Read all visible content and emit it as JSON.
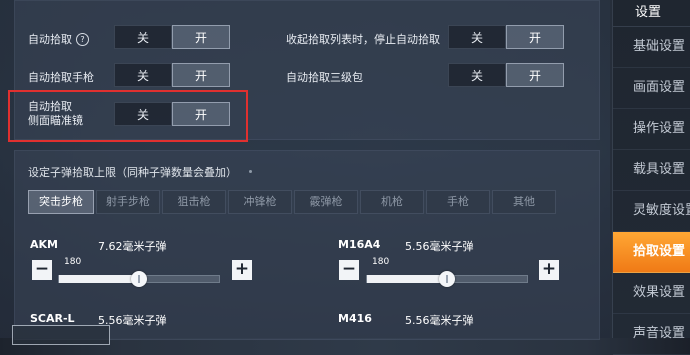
{
  "sidebar": {
    "header": "设置",
    "items": [
      {
        "label": "基础设置",
        "active": false
      },
      {
        "label": "画面设置",
        "active": false
      },
      {
        "label": "操作设置",
        "active": false
      },
      {
        "label": "载具设置",
        "active": false
      },
      {
        "label": "灵敏度设置",
        "active": false
      },
      {
        "label": "拾取设置",
        "active": true
      },
      {
        "label": "效果设置",
        "active": false
      },
      {
        "label": "声音设置",
        "active": false
      }
    ]
  },
  "pickup": {
    "auto_pickup": {
      "label": "自动拾取",
      "off": "关",
      "on": "开",
      "selected": "on"
    },
    "auto_pickup_pistol": {
      "label": "自动拾取手枪",
      "off": "关",
      "on": "开",
      "selected": "on"
    },
    "auto_pickup_side_scope": {
      "label_line1": "自动拾取",
      "label_line2": "侧面瞄准镜",
      "off": "关",
      "on": "开",
      "selected": "on"
    },
    "stop_on_collapse": {
      "label": "收起拾取列表时，停止自动拾取",
      "off": "关",
      "on": "开",
      "selected": "on"
    },
    "auto_pickup_lvl3_bag": {
      "label": "自动拾取三级包",
      "off": "关",
      "on": "开",
      "selected": "on"
    }
  },
  "ammo_limit": {
    "title": "设定子弹拾取上限（同种子弹数量会叠加）",
    "tabs": [
      "突击步枪",
      "射手步枪",
      "狙击枪",
      "冲锋枪",
      "霰弹枪",
      "机枪",
      "手枪",
      "其他"
    ],
    "active_tab": 0,
    "guns": [
      {
        "name": "AKM",
        "ammo": "7.62毫米子弹",
        "value": "180",
        "fraction": 0.5
      },
      {
        "name": "M16A4",
        "ammo": "5.56毫米子弹",
        "value": "180",
        "fraction": 0.5
      }
    ],
    "partial_guns": [
      {
        "name": "SCAR-L",
        "ammo": "5.56毫米子弹"
      },
      {
        "name": "M416",
        "ammo": "5.56毫米子弹"
      }
    ],
    "minus": "−",
    "plus": "+"
  }
}
